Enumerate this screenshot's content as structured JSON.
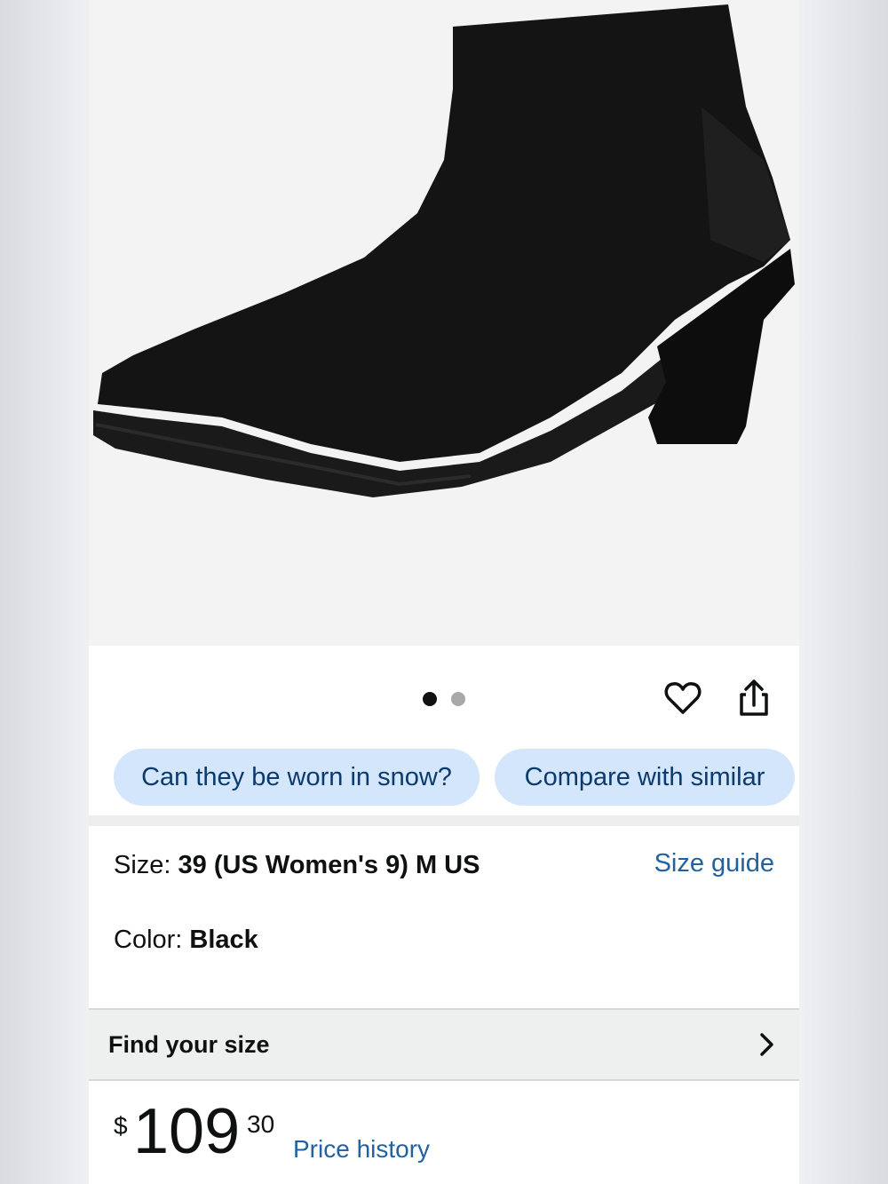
{
  "product": {
    "image_alt": "Black knit ankle boot with block heel",
    "carousel": {
      "count": 2,
      "active_index": 0
    }
  },
  "chips": [
    {
      "label": "Can they be worn in snow?"
    },
    {
      "label": "Compare with similar"
    }
  ],
  "variations": {
    "size_label": "Size: ",
    "size_value": "39 (US Women's 9) M US",
    "size_guide": "Size guide",
    "color_label": "Color: ",
    "color_value": "Black"
  },
  "find_size": {
    "label": "Find your size"
  },
  "price": {
    "currency": "$",
    "whole": "109",
    "fraction": "30",
    "history_link": "Price history"
  },
  "colors": {
    "chip_bg": "#d4e6fb",
    "chip_text": "#0b3a6e",
    "link": "#2162a1"
  }
}
